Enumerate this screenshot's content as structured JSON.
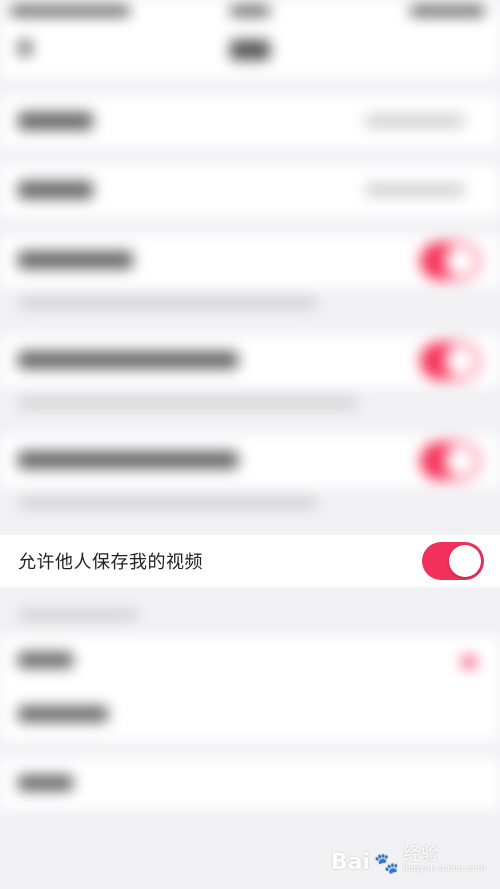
{
  "settings": {
    "highlighted_row": {
      "label": "允许他人保存我的视频",
      "toggle_on": true
    }
  },
  "watermark": {
    "brand": "Bai",
    "brand_suffix": "经验",
    "url": "jingyan.baidu.com"
  },
  "colors": {
    "accent": "#f1315b",
    "page_bg": "#f2f2f5"
  }
}
